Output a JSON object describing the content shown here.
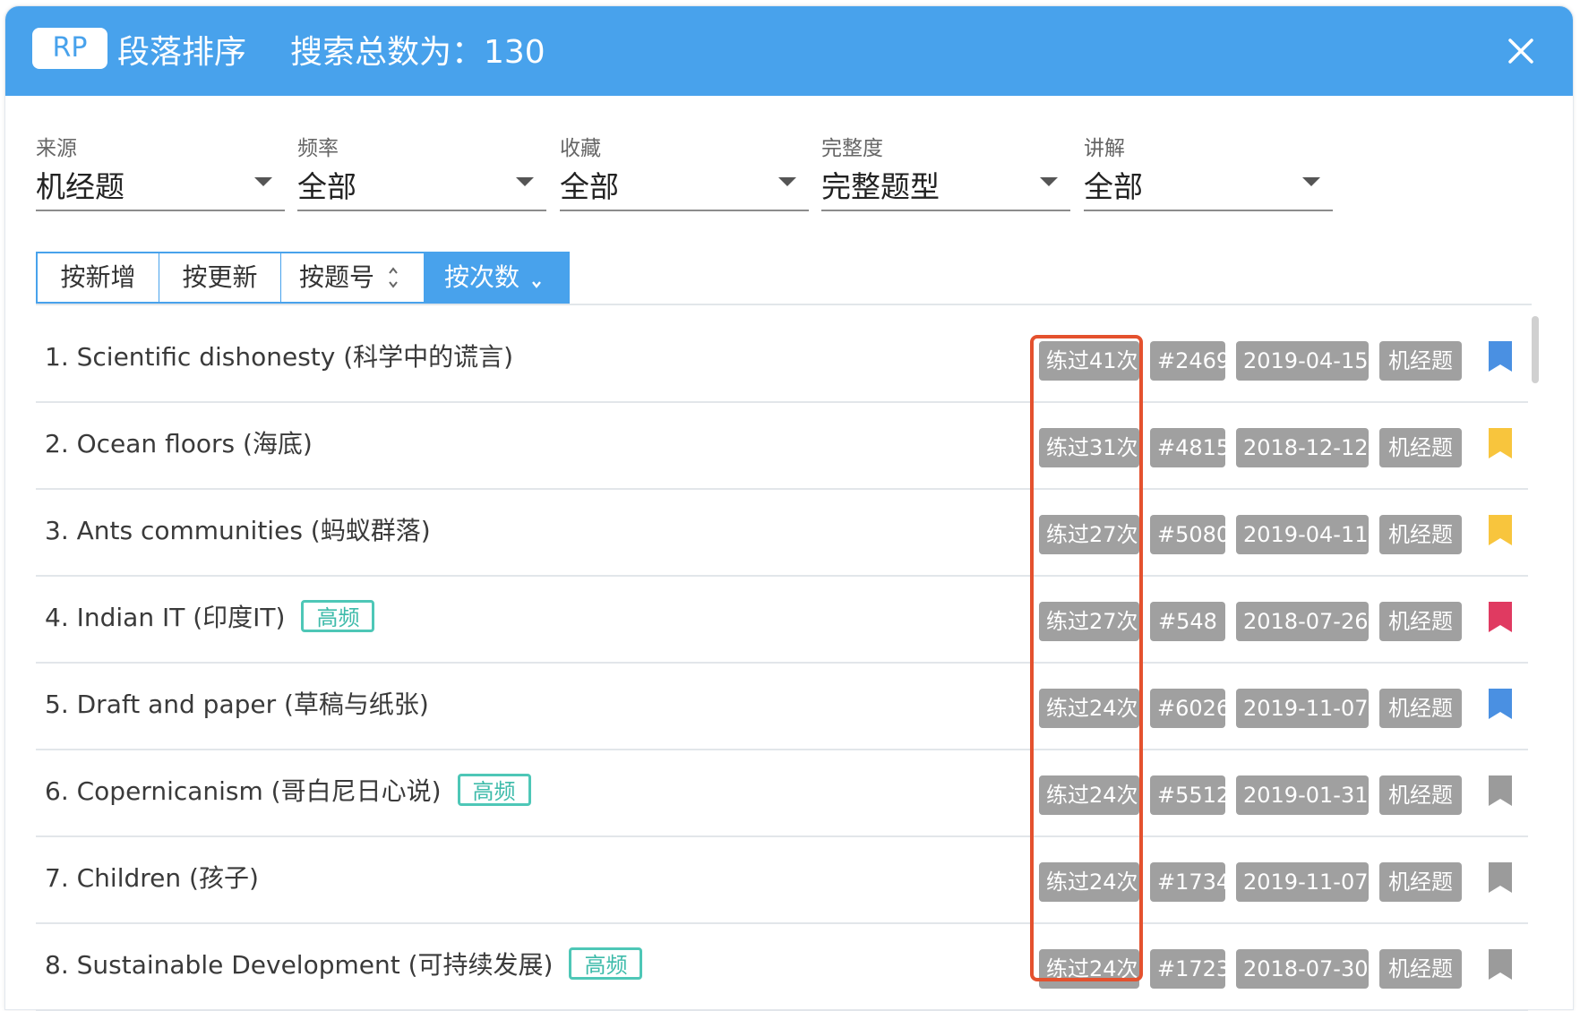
{
  "header": {
    "badge": "RP",
    "title": "段落排序",
    "total": "搜索总数为：130"
  },
  "filters": [
    {
      "label": "来源",
      "value": "机经题"
    },
    {
      "label": "频率",
      "value": "全部"
    },
    {
      "label": "收藏",
      "value": "全部"
    },
    {
      "label": "完整度",
      "value": "完整题型"
    },
    {
      "label": "讲解",
      "value": "全部"
    }
  ],
  "sort": {
    "buttons": [
      "按新增",
      "按更新",
      "按题号",
      "按次数"
    ],
    "active": "按次数"
  },
  "colors": {
    "accent": "#48a2ec",
    "tag_gray": "#a0a0a0",
    "hot_green": "#4ec7b7",
    "highlight_red": "#e4512e",
    "bookmark_blue": "#4a90e2",
    "bookmark_yellow": "#f8c53d",
    "bookmark_red": "#e03a61",
    "bookmark_gray": "#9b9b9b"
  },
  "rows": [
    {
      "title": "1. Scientific dishonesty (科学中的谎言)",
      "hot": "",
      "count": "练过41次",
      "num": "#2469",
      "date": "2019-04-15",
      "src": "机经题",
      "bookmark": "blue"
    },
    {
      "title": "2. Ocean floors (海底)",
      "hot": "",
      "count": "练过31次",
      "num": "#4815",
      "date": "2018-12-12",
      "src": "机经题",
      "bookmark": "yellow"
    },
    {
      "title": "3. Ants communities (蚂蚁群落)",
      "hot": "",
      "count": "练过27次",
      "num": "#5080",
      "date": "2019-04-11",
      "src": "机经题",
      "bookmark": "yellow"
    },
    {
      "title": "4. Indian IT (印度IT)",
      "hot": "高频",
      "count": "练过27次",
      "num": "#548",
      "date": "2018-07-26",
      "src": "机经题",
      "bookmark": "red"
    },
    {
      "title": "5. Draft and paper (草稿与纸张)",
      "hot": "",
      "count": "练过24次",
      "num": "#6026",
      "date": "2019-11-07",
      "src": "机经题",
      "bookmark": "blue"
    },
    {
      "title": "6. Copernicanism (哥白尼日心说)",
      "hot": "高频",
      "count": "练过24次",
      "num": "#5512",
      "date": "2019-01-31",
      "src": "机经题",
      "bookmark": "gray"
    },
    {
      "title": "7. Children (孩子)",
      "hot": "",
      "count": "练过24次",
      "num": "#1734",
      "date": "2019-11-07",
      "src": "机经题",
      "bookmark": "gray"
    },
    {
      "title": "8. Sustainable Development (可持续发展)",
      "hot": "高频",
      "count": "练过24次",
      "num": "#1723",
      "date": "2018-07-30",
      "src": "机经题",
      "bookmark": "gray"
    }
  ]
}
